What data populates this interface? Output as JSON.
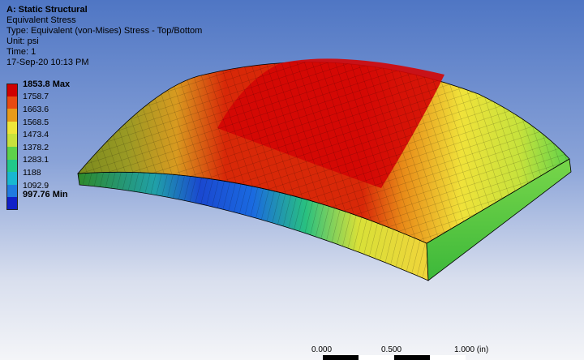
{
  "info": {
    "analysis": "A: Static Structural",
    "result_name": "Equivalent Stress",
    "type_line": "Type: Equivalent (von-Mises) Stress - Top/Bottom",
    "unit_line": "Unit: psi",
    "time_line": "Time: 1",
    "timestamp": "17-Sep-20 10:13 PM"
  },
  "legend": {
    "levels": [
      {
        "label": "1853.8 Max",
        "color": "#d00000",
        "bold": true
      },
      {
        "label": "1758.7",
        "color": "#e84a12",
        "bold": false
      },
      {
        "label": "1663.6",
        "color": "#e89a1a",
        "bold": false
      },
      {
        "label": "1568.5",
        "color": "#f0e63a",
        "bold": false
      },
      {
        "label": "1473.4",
        "color": "#c8e23c",
        "bold": false
      },
      {
        "label": "1378.2",
        "color": "#5ed24a",
        "bold": false
      },
      {
        "label": "1283.1",
        "color": "#21c88a",
        "bold": false
      },
      {
        "label": "1188",
        "color": "#18b7d0",
        "bold": false
      },
      {
        "label": "1092.9",
        "color": "#1f7ae0",
        "bold": false
      }
    ],
    "min_label": "997.76 Min",
    "min_color": "#1020c8"
  },
  "scale_bar": {
    "ticks": [
      "0.000",
      "0.500",
      "1.000 (in)"
    ]
  },
  "colors": {
    "max_red": "#d00000",
    "orange": "#e89a1a",
    "yellow": "#f0e63a",
    "green": "#5ed24a",
    "olive": "#8a8a22"
  }
}
